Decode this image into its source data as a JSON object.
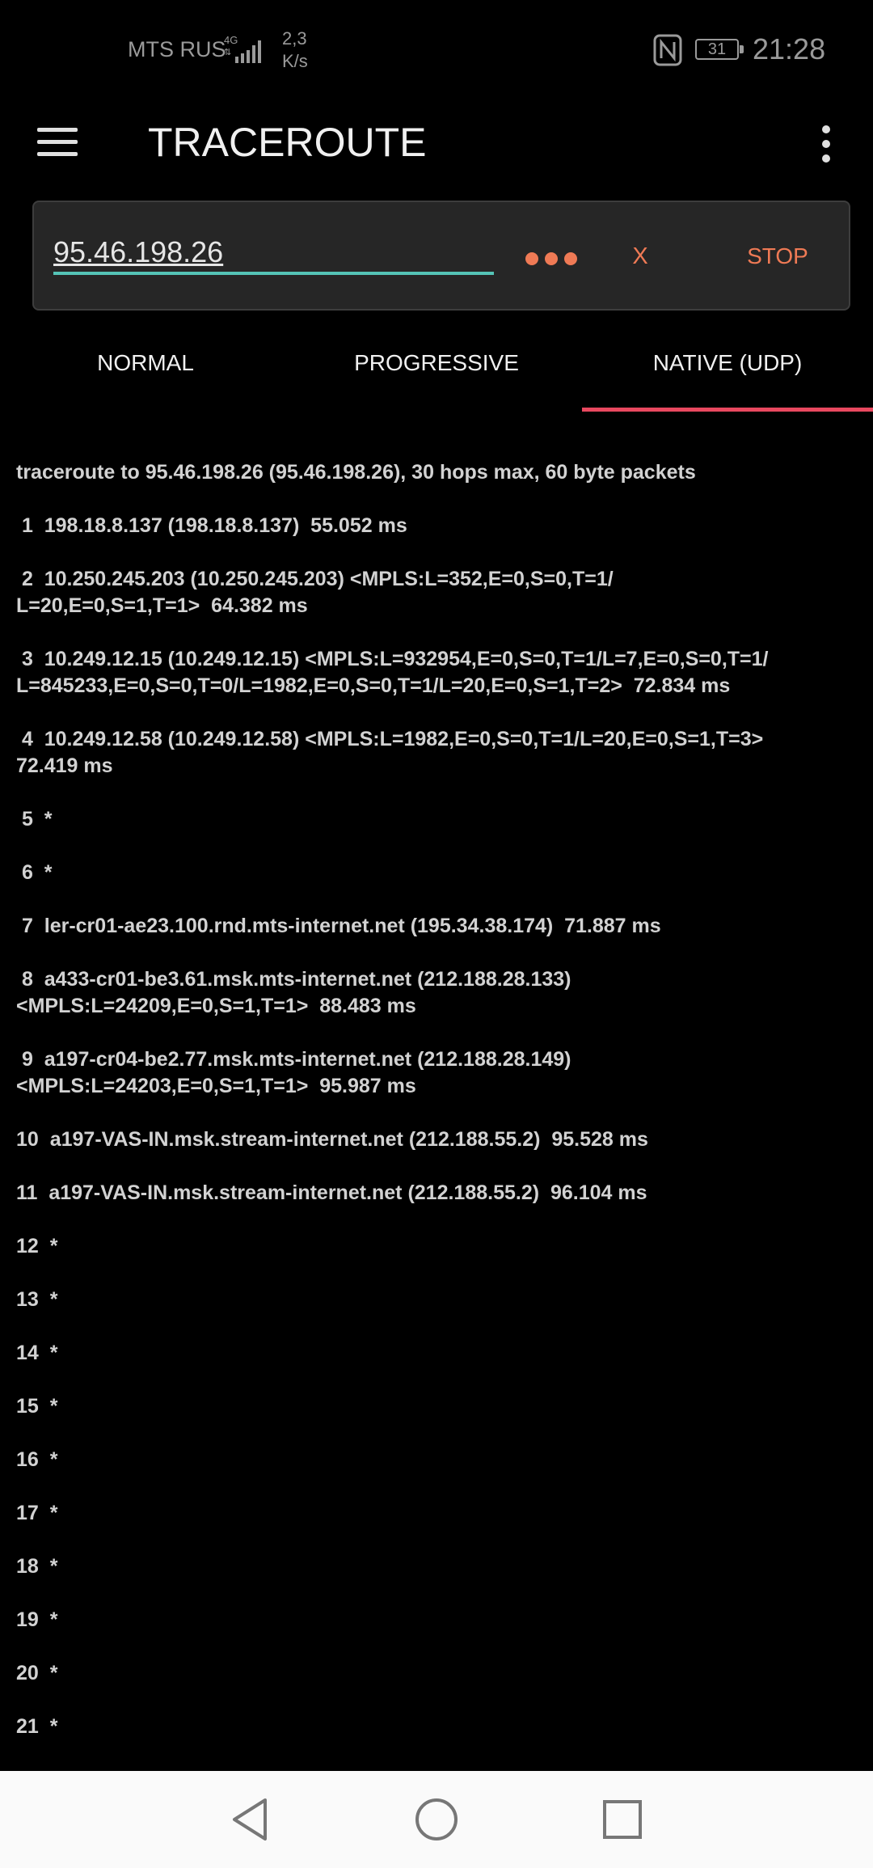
{
  "status_bar": {
    "carrier": "MTS RUS",
    "network_type": "4G",
    "speed_value": "2,3",
    "speed_unit": "K/s",
    "battery": "31",
    "time": "21:28"
  },
  "app_bar": {
    "title": "TRACEROUTE",
    "menu_icon": "hamburger-menu-icon",
    "more_icon": "more-vertical-icon"
  },
  "input": {
    "host_value": "95.46.198.26",
    "clear_label": "X",
    "stop_label": "STOP",
    "accent_color": "#ef7a55"
  },
  "tabs": {
    "items": [
      {
        "label": "NORMAL"
      },
      {
        "label": "PROGRESSIVE"
      },
      {
        "label": "NATIVE (UDP)"
      }
    ],
    "selected_index": 2,
    "indicator_color": "#e8485f"
  },
  "output": {
    "lines": [
      "traceroute to 95.46.198.26 (95.46.198.26), 30 hops max, 60 byte packets",
      " 1  198.18.8.137 (198.18.8.137)  55.052 ms",
      " 2  10.250.245.203 (10.250.245.203) <MPLS:L=352,E=0,S=0,T=1/\nL=20,E=0,S=1,T=1>  64.382 ms",
      " 3  10.249.12.15 (10.249.12.15) <MPLS:L=932954,E=0,S=0,T=1/L=7,E=0,S=0,T=1/\nL=845233,E=0,S=0,T=0/L=1982,E=0,S=0,T=1/L=20,E=0,S=1,T=2>  72.834 ms",
      " 4  10.249.12.58 (10.249.12.58) <MPLS:L=1982,E=0,S=0,T=1/L=20,E=0,S=1,T=3>\n72.419 ms",
      " 5  *",
      " 6  *",
      " 7  ler-cr01-ae23.100.rnd.mts-internet.net (195.34.38.174)  71.887 ms",
      " 8  a433-cr01-be3.61.msk.mts-internet.net (212.188.28.133)\n<MPLS:L=24209,E=0,S=1,T=1>  88.483 ms",
      " 9  a197-cr04-be2.77.msk.mts-internet.net (212.188.28.149)\n<MPLS:L=24203,E=0,S=1,T=1>  95.987 ms",
      "10  a197-VAS-IN.msk.stream-internet.net (212.188.55.2)  95.528 ms",
      "11  a197-VAS-IN.msk.stream-internet.net (212.188.55.2)  96.104 ms",
      "12  *",
      "13  *",
      "14  *",
      "15  *",
      "16  *",
      "17  *",
      "18  *",
      "19  *",
      "20  *",
      "21  *"
    ]
  },
  "nav_bar": {
    "back_icon": "back-triangle-icon",
    "home_icon": "home-circle-icon",
    "recents_icon": "recents-square-icon"
  }
}
